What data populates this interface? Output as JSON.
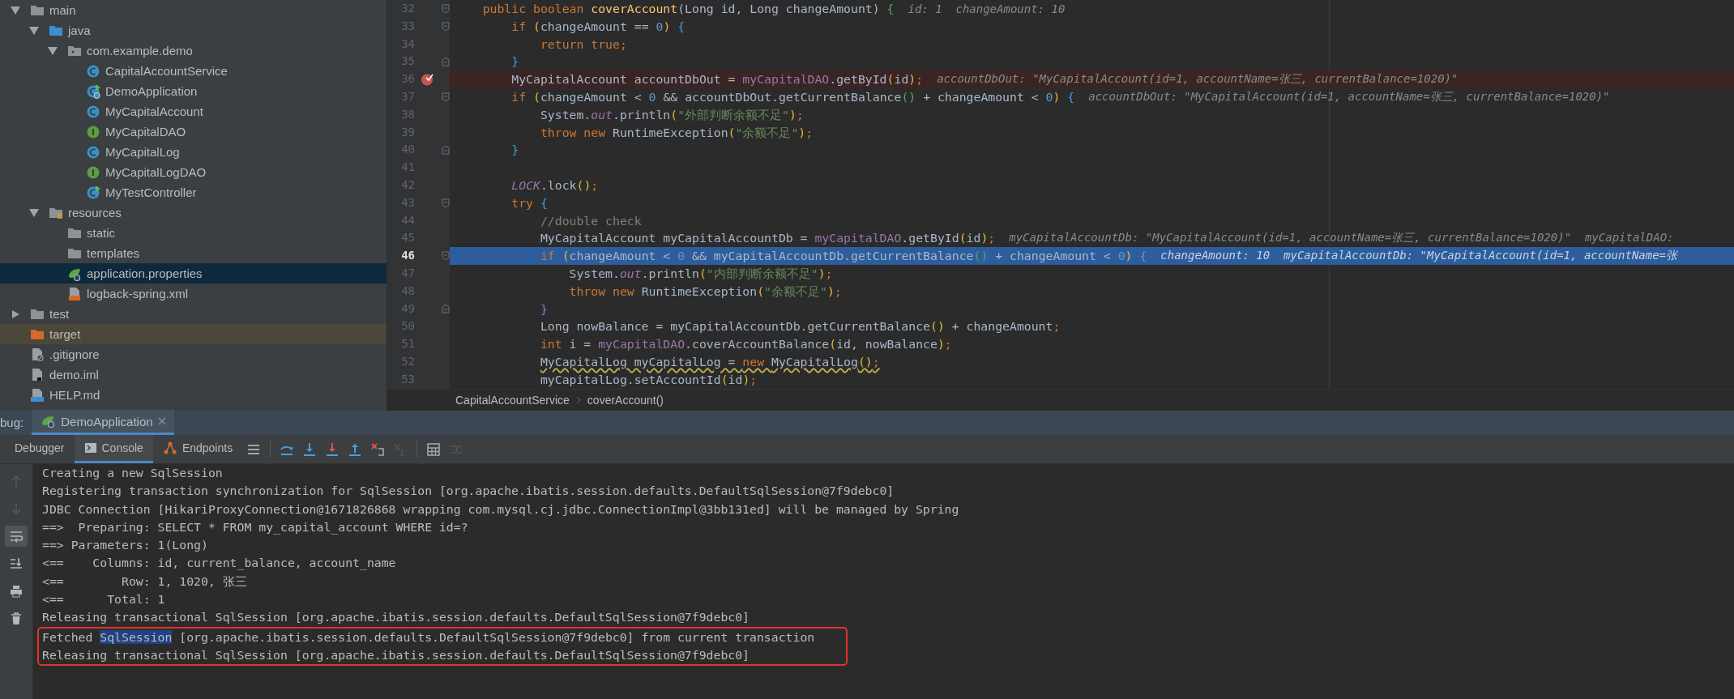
{
  "project_tree": {
    "items": [
      {
        "label": "main",
        "kind": "folder",
        "selected": false,
        "expanded": true,
        "children": [
          {
            "label": "java",
            "kind": "source_folder",
            "selected": false,
            "expanded": true,
            "children": [
              {
                "label": "com.example.demo",
                "kind": "package",
                "selected": false,
                "expanded": true,
                "children": [
                  {
                    "label": "CapitalAccountService",
                    "kind": "class",
                    "selected": false
                  },
                  {
                    "label": "DemoApplication",
                    "kind": "app_class",
                    "selected": false
                  },
                  {
                    "label": "MyCapitalAccount",
                    "kind": "class",
                    "selected": false
                  },
                  {
                    "label": "MyCapitalDAO",
                    "kind": "interface",
                    "selected": false
                  },
                  {
                    "label": "MyCapitalLog",
                    "kind": "class",
                    "selected": false
                  },
                  {
                    "label": "MyCapitalLogDAO",
                    "kind": "interface",
                    "selected": false
                  },
                  {
                    "label": "MyTestController",
                    "kind": "controller",
                    "selected": false
                  }
                ]
              }
            ]
          },
          {
            "label": "resources",
            "kind": "resources_folder",
            "selected": false,
            "expanded": true,
            "children": [
              {
                "label": "static",
                "kind": "folder",
                "selected": false
              },
              {
                "label": "templates",
                "kind": "folder",
                "selected": false
              },
              {
                "label": "application.properties",
                "kind": "spring_properties",
                "selected": true
              },
              {
                "label": "logback-spring.xml",
                "kind": "xml_file",
                "selected": false
              }
            ]
          }
        ]
      },
      {
        "label": "test",
        "kind": "folder",
        "selected": false,
        "expanded": false
      },
      {
        "label": "target",
        "kind": "excluded_folder",
        "selected": false
      },
      {
        "label": ".gitignore",
        "kind": "ignore_file",
        "selected": false
      },
      {
        "label": "demo.iml",
        "kind": "module_file",
        "selected": false
      },
      {
        "label": "HELP.md",
        "kind": "markdown_file",
        "selected": false
      }
    ]
  },
  "editor": {
    "lines": [
      {
        "number": "32",
        "fold_start": true,
        "fold_end": false,
        "breakpoint": false,
        "current": false,
        "warning": false,
        "hint": "id: 1  changeAmount: 10",
        "segments": [
          {
            "kind": "keyword",
            "text": "    public boolean "
          },
          {
            "kind": "declaration",
            "text": "coverAccount"
          },
          {
            "kind": "plain",
            "text": "(Long id, Long changeAmount) "
          },
          {
            "kind": "brace1",
            "text": "{"
          }
        ]
      },
      {
        "number": "33",
        "fold_start": true,
        "fold_end": false,
        "breakpoint": false,
        "current": false,
        "warning": false,
        "segments": [
          {
            "kind": "keyword",
            "text": "        if "
          },
          {
            "kind": "paren1",
            "text": "("
          },
          {
            "kind": "plain",
            "text": "changeAmount == "
          },
          {
            "kind": "number",
            "text": "0"
          },
          {
            "kind": "paren1",
            "text": ")"
          },
          {
            "kind": "brace2",
            "text": " {"
          }
        ]
      },
      {
        "number": "34",
        "fold_start": false,
        "fold_end": false,
        "breakpoint": false,
        "current": false,
        "warning": false,
        "segments": [
          {
            "kind": "keyword",
            "text": "            return true;"
          }
        ]
      },
      {
        "number": "35",
        "fold_start": false,
        "fold_end": true,
        "breakpoint": false,
        "current": false,
        "warning": false,
        "segments": [
          {
            "kind": "brace2",
            "text": "        }"
          }
        ]
      },
      {
        "number": "36",
        "fold_start": false,
        "fold_end": false,
        "breakpoint": true,
        "current": false,
        "warning": false,
        "hint": "accountDbOut: \"MyCapitalAccount(id=1, accountName=张三, currentBalance=1020)\"",
        "segments": [
          {
            "kind": "plain",
            "text": "        MyCapitalAccount accountDbOut = "
          },
          {
            "kind": "field",
            "text": "myCapitalDAO"
          },
          {
            "kind": "plain",
            "text": ".getById"
          },
          {
            "kind": "paren1",
            "text": "("
          },
          {
            "kind": "plain",
            "text": "id"
          },
          {
            "kind": "paren1",
            "text": ")"
          },
          {
            "kind": "keyword",
            "text": ";"
          }
        ]
      },
      {
        "number": "37",
        "fold_start": true,
        "fold_end": false,
        "breakpoint": false,
        "current": false,
        "warning": false,
        "hint": "accountDbOut: \"MyCapitalAccount(id=1, accountName=张三, currentBalance=1020)\"",
        "segments": [
          {
            "kind": "keyword",
            "text": "        if "
          },
          {
            "kind": "paren1",
            "text": "("
          },
          {
            "kind": "plain",
            "text": "changeAmount < "
          },
          {
            "kind": "number",
            "text": "0"
          },
          {
            "kind": "plain",
            "text": " && accountDbOut.getCurrentBalance"
          },
          {
            "kind": "paren2",
            "text": "()"
          },
          {
            "kind": "plain",
            "text": " + changeAmount < "
          },
          {
            "kind": "number",
            "text": "0"
          },
          {
            "kind": "paren1",
            "text": ")"
          },
          {
            "kind": "brace2",
            "text": " {"
          }
        ]
      },
      {
        "number": "38",
        "fold_start": false,
        "fold_end": false,
        "breakpoint": false,
        "current": false,
        "warning": false,
        "segments": [
          {
            "kind": "plain",
            "text": "            System."
          },
          {
            "kind": "static",
            "text": "out"
          },
          {
            "kind": "plain",
            "text": ".println"
          },
          {
            "kind": "paren1",
            "text": "("
          },
          {
            "kind": "string",
            "text": "\"外部判断余额不足\""
          },
          {
            "kind": "paren1",
            "text": ")"
          },
          {
            "kind": "keyword",
            "text": ";"
          }
        ]
      },
      {
        "number": "39",
        "fold_start": false,
        "fold_end": false,
        "breakpoint": false,
        "current": false,
        "warning": false,
        "segments": [
          {
            "kind": "keyword",
            "text": "            throw new "
          },
          {
            "kind": "plain",
            "text": "RuntimeException"
          },
          {
            "kind": "paren1",
            "text": "("
          },
          {
            "kind": "string",
            "text": "\"余额不足\""
          },
          {
            "kind": "paren1",
            "text": ")"
          },
          {
            "kind": "keyword",
            "text": ";"
          }
        ]
      },
      {
        "number": "40",
        "fold_start": false,
        "fold_end": true,
        "breakpoint": false,
        "current": false,
        "warning": false,
        "segments": [
          {
            "kind": "brace2",
            "text": "        }"
          }
        ]
      },
      {
        "number": "41",
        "fold_start": false,
        "fold_end": false,
        "breakpoint": false,
        "current": false
      },
      {
        "number": "42",
        "fold_start": false,
        "fold_end": false,
        "breakpoint": false,
        "current": false,
        "warning": false,
        "segments": [
          {
            "kind": "static",
            "text": "        LOCK"
          },
          {
            "kind": "plain",
            "text": ".lock"
          },
          {
            "kind": "paren1",
            "text": "()"
          },
          {
            "kind": "keyword",
            "text": ";"
          }
        ]
      },
      {
        "number": "43",
        "fold_start": true,
        "fold_end": false,
        "breakpoint": false,
        "current": false,
        "warning": false,
        "segments": [
          {
            "kind": "keyword",
            "text": "        try "
          },
          {
            "kind": "brace2",
            "text": "{"
          }
        ]
      },
      {
        "number": "44",
        "fold_start": false,
        "fold_end": false,
        "breakpoint": false,
        "current": false,
        "warning": false,
        "segments": [
          {
            "kind": "comment",
            "text": "            //double check"
          }
        ]
      },
      {
        "number": "45",
        "fold_start": false,
        "fold_end": false,
        "breakpoint": false,
        "current": false,
        "warning": false,
        "hint": "myCapitalAccountDb: \"MyCapitalAccount(id=1, accountName=张三, currentBalance=1020)\"  myCapitalDAO:",
        "segments": [
          {
            "kind": "plain",
            "text": "            MyCapitalAccount myCapitalAccountDb = "
          },
          {
            "kind": "field",
            "text": "myCapitalDAO"
          },
          {
            "kind": "plain",
            "text": ".getById"
          },
          {
            "kind": "paren1",
            "text": "("
          },
          {
            "kind": "plain",
            "text": "id"
          },
          {
            "kind": "paren1",
            "text": ")"
          },
          {
            "kind": "keyword",
            "text": ";"
          }
        ]
      },
      {
        "number": "46",
        "fold_start": true,
        "fold_end": false,
        "breakpoint": false,
        "current": true,
        "warning": false,
        "hint": "changeAmount: 10  myCapitalAccountDb: \"MyCapitalAccount(id=1, accountName=张",
        "segments": [
          {
            "kind": "keyword",
            "text": "            if "
          },
          {
            "kind": "paren1",
            "text": "("
          },
          {
            "kind": "plain",
            "text": "changeAmount < "
          },
          {
            "kind": "number",
            "text": "0"
          },
          {
            "kind": "plain",
            "text": " && myCapitalAccountDb.getCurrentBalance"
          },
          {
            "kind": "paren2",
            "text": "()"
          },
          {
            "kind": "plain",
            "text": " + changeAmount < "
          },
          {
            "kind": "number",
            "text": "0"
          },
          {
            "kind": "paren1",
            "text": ")"
          },
          {
            "kind": "brace3",
            "text": " {"
          }
        ]
      },
      {
        "number": "47",
        "fold_start": false,
        "fold_end": false,
        "breakpoint": false,
        "current": false,
        "warning": false,
        "segments": [
          {
            "kind": "plain",
            "text": "                System."
          },
          {
            "kind": "static",
            "text": "out"
          },
          {
            "kind": "plain",
            "text": ".println"
          },
          {
            "kind": "paren1",
            "text": "("
          },
          {
            "kind": "string",
            "text": "\"内部判断余额不足\""
          },
          {
            "kind": "paren1",
            "text": ")"
          },
          {
            "kind": "keyword",
            "text": ";"
          }
        ]
      },
      {
        "number": "48",
        "fold_start": false,
        "fold_end": false,
        "breakpoint": false,
        "current": false,
        "warning": false,
        "segments": [
          {
            "kind": "keyword",
            "text": "                throw new "
          },
          {
            "kind": "plain",
            "text": "RuntimeException"
          },
          {
            "kind": "paren1",
            "text": "("
          },
          {
            "kind": "string",
            "text": "\"余额不足\""
          },
          {
            "kind": "paren1",
            "text": ")"
          },
          {
            "kind": "keyword",
            "text": ";"
          }
        ]
      },
      {
        "number": "49",
        "fold_start": false,
        "fold_end": true,
        "breakpoint": false,
        "current": false,
        "warning": false,
        "segments": [
          {
            "kind": "brace3",
            "text": "            }"
          }
        ]
      },
      {
        "number": "50",
        "fold_start": false,
        "fold_end": false,
        "breakpoint": false,
        "current": false,
        "warning": false,
        "segments": [
          {
            "kind": "plain",
            "text": "            Long nowBalance = myCapitalAccountDb.getCurrentBalance"
          },
          {
            "kind": "paren1",
            "text": "()"
          },
          {
            "kind": "plain",
            "text": " + changeAmount"
          },
          {
            "kind": "keyword",
            "text": ";"
          }
        ]
      },
      {
        "number": "51",
        "fold_start": false,
        "fold_end": false,
        "breakpoint": false,
        "current": false,
        "warning": false,
        "segments": [
          {
            "kind": "keyword",
            "text": "            int "
          },
          {
            "kind": "plain",
            "text": "i = "
          },
          {
            "kind": "field",
            "text": "myCapitalDAO"
          },
          {
            "kind": "plain",
            "text": ".coverAccountBalance"
          },
          {
            "kind": "paren1",
            "text": "("
          },
          {
            "kind": "plain",
            "text": "id, nowBalance"
          },
          {
            "kind": "paren1",
            "text": ")"
          },
          {
            "kind": "keyword",
            "text": ";"
          }
        ]
      },
      {
        "number": "52",
        "fold_start": false,
        "fold_end": false,
        "breakpoint": false,
        "current": false,
        "warning": true,
        "segments": [
          {
            "kind": "plain",
            "text": "            MyCapitalLog myCapitalLog = "
          },
          {
            "kind": "keyword",
            "text": "new "
          },
          {
            "kind": "plain",
            "text": "MyCapitalLog"
          },
          {
            "kind": "paren1",
            "text": "()"
          },
          {
            "kind": "keyword",
            "text": ";"
          }
        ]
      },
      {
        "number": "53",
        "fold_start": false,
        "fold_end": false,
        "breakpoint": false,
        "current": false,
        "warning": false,
        "segments": [
          {
            "kind": "plain",
            "text": "            myCapitalLog.setAccountId"
          },
          {
            "kind": "paren1",
            "text": "("
          },
          {
            "kind": "plain",
            "text": "id"
          },
          {
            "kind": "paren1",
            "text": ")"
          },
          {
            "kind": "keyword",
            "text": ";"
          }
        ]
      }
    ],
    "breadcrumbs": [
      "CapitalAccountService",
      "coverAccount()"
    ]
  },
  "debug": {
    "label": "bug:",
    "tabs": [
      {
        "label": "DemoApplication",
        "selected": true
      }
    ],
    "view_tabs": [
      {
        "label": "Debugger",
        "kind": "plain",
        "selected": false
      },
      {
        "label": "Console",
        "kind": "console",
        "selected": true
      },
      {
        "label": "Endpoints",
        "kind": "endpoints",
        "selected": false
      }
    ],
    "toolbar": [
      {
        "kind": "menu",
        "disabled": false
      },
      {
        "kind": "step_over",
        "disabled": false
      },
      {
        "kind": "step_into",
        "disabled": false
      },
      {
        "kind": "force_step_into",
        "disabled": false
      },
      {
        "kind": "step_out",
        "disabled": false
      },
      {
        "kind": "drop_frame",
        "disabled": false
      },
      {
        "kind": "run_to_cursor",
        "disabled": true
      },
      {
        "kind": "evaluate",
        "disabled": false
      },
      {
        "kind": "trace",
        "disabled": true
      }
    ],
    "side_tools": [
      {
        "kind": "up",
        "disabled": true,
        "on": false
      },
      {
        "kind": "down",
        "disabled": true,
        "on": false
      },
      {
        "kind": "soft_wrap",
        "disabled": false,
        "on": true
      },
      {
        "kind": "scroll_end",
        "disabled": false,
        "on": false
      },
      {
        "kind": "print",
        "disabled": false,
        "on": false
      },
      {
        "kind": "clear",
        "disabled": false,
        "on": false
      }
    ],
    "console": {
      "lines": [
        {
          "boxed": false,
          "segments": [
            {
              "text": "Creating a new SqlSession",
              "selected": false
            }
          ]
        },
        {
          "boxed": false,
          "segments": [
            {
              "text": "Registering transaction synchronization for SqlSession [org.apache.ibatis.session.defaults.DefaultSqlSession@7f9debc0]",
              "selected": false
            }
          ]
        },
        {
          "boxed": false,
          "segments": [
            {
              "text": "JDBC Connection [HikariProxyConnection@1671826868 wrapping com.mysql.cj.jdbc.ConnectionImpl@3bb131ed] will be managed by Spring",
              "selected": false
            }
          ]
        },
        {
          "boxed": false,
          "segments": [
            {
              "text": "==>  Preparing: SELECT * FROM my_capital_account WHERE id=?",
              "selected": false
            }
          ]
        },
        {
          "boxed": false,
          "segments": [
            {
              "text": "==> Parameters: 1(Long)",
              "selected": false
            }
          ]
        },
        {
          "boxed": false,
          "segments": [
            {
              "text": "<==    Columns: id, current_balance, account_name",
              "selected": false
            }
          ]
        },
        {
          "boxed": false,
          "segments": [
            {
              "text": "<==        Row: 1, 1020, 张三",
              "selected": false
            }
          ]
        },
        {
          "boxed": false,
          "segments": [
            {
              "text": "<==      Total: 1",
              "selected": false
            }
          ]
        },
        {
          "boxed": false,
          "segments": [
            {
              "text": "Releasing transactional SqlSession [org.apache.ibatis.session.defaults.DefaultSqlSession@7f9debc0]",
              "selected": false
            }
          ]
        },
        {
          "boxed": true,
          "segments": [
            {
              "text": "Fetched ",
              "selected": false
            },
            {
              "text": "SqlSession",
              "selected": true
            },
            {
              "text": " [org.apache.ibatis.session.defaults.DefaultSqlSession@7f9debc0] from current transaction",
              "selected": false
            }
          ]
        },
        {
          "boxed": true,
          "segments": [
            {
              "text": "Releasing transactional SqlSession [org.apache.ibatis.session.defaults.DefaultSqlSession@7f9debc0]",
              "selected": false
            }
          ]
        }
      ]
    }
  }
}
